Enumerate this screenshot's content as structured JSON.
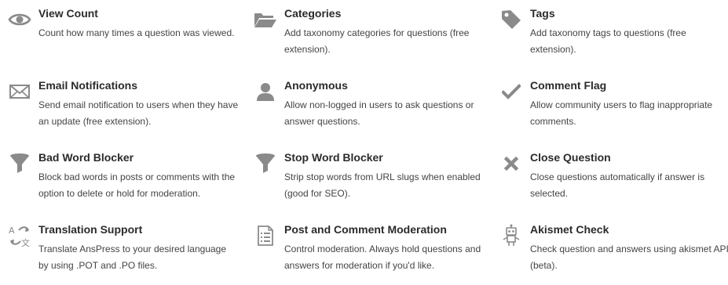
{
  "colors": {
    "icon": "#8a8a8a",
    "title": "#2b2b2b",
    "text": "#444444",
    "background": "#ffffff"
  },
  "features": [
    {
      "icon": "eye-icon",
      "title": "View Count",
      "description": "Count how many times a question was viewed."
    },
    {
      "icon": "folder-icon",
      "title": "Categories",
      "description": "Add taxonomy categories for questions (free extension)."
    },
    {
      "icon": "tag-icon",
      "title": "Tags",
      "description": "Add taxonomy tags to questions (free extension)."
    },
    {
      "icon": "envelope-icon",
      "title": "Email Notifications",
      "description": "Send email notification to users when they have an update (free extension)."
    },
    {
      "icon": "user-icon",
      "title": "Anonymous",
      "description": "Allow non-logged in users to ask questions or answer questions."
    },
    {
      "icon": "check-icon",
      "title": "Comment Flag",
      "description": "Allow community users to flag inappropriate comments."
    },
    {
      "icon": "filter-icon",
      "title": "Bad Word Blocker",
      "description": "Block bad words in posts or comments with the option to delete or hold for moderation."
    },
    {
      "icon": "filter-icon",
      "title": "Stop Word Blocker",
      "description": "Strip stop words from URL slugs when enabled (good for SEO)."
    },
    {
      "icon": "close-icon",
      "title": "Close Question",
      "description": "Close questions automatically if answer is selected."
    },
    {
      "icon": "translate-icon",
      "title": "Translation Support",
      "description": "Translate AnsPress to your desired language by using .POT and .PO files."
    },
    {
      "icon": "document-list-icon",
      "title": "Post and Comment Moderation",
      "description": "Control moderation. Always hold questions and answers for moderation if you'd like."
    },
    {
      "icon": "robot-icon",
      "title": "Akismet Check",
      "description": "Check question and answers using akismet API (beta)."
    }
  ]
}
